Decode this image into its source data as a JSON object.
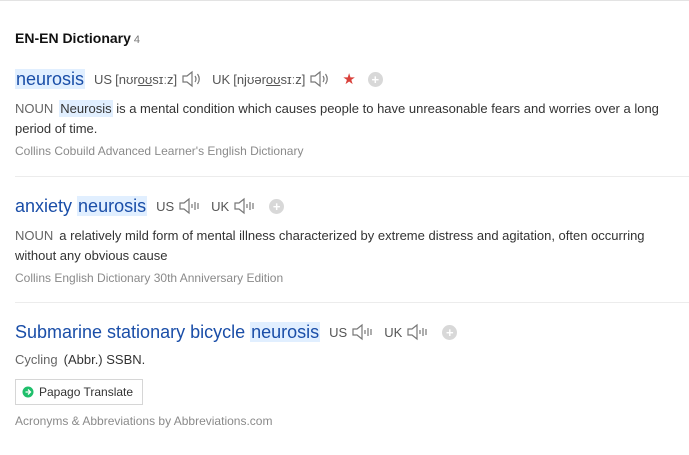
{
  "header": {
    "title": "EN-EN Dictionary",
    "count": "4"
  },
  "entries": [
    {
      "headword_plain": "",
      "headword_hl": "neurosis",
      "us_label": "US",
      "us_ipa_1": "[nʊr",
      "us_ipa_u": "oʊ",
      "us_ipa_2": "sɪːz]",
      "uk_label": "UK",
      "uk_ipa_1": "[njʊər",
      "uk_ipa_u": "oʊ",
      "uk_ipa_2": "sɪːz]",
      "pos": "NOUN",
      "def_kw": "Neurosis",
      "def_rest": " is a mental condition which causes people to have unreasonable fears and worries over a long period of time.",
      "source": "Collins Cobuild Advanced Learner's English Dictionary"
    },
    {
      "headword_plain": "anxiety ",
      "headword_hl": "neurosis",
      "us_label": "US",
      "uk_label": "UK",
      "pos": "NOUN",
      "def_rest": "a relatively mild form of mental illness characterized by extreme distress and agitation, often occurring without any obvious cause",
      "source": "Collins English Dictionary 30th Anniversary Edition"
    },
    {
      "headword_plain": "Submarine stationary bicycle ",
      "headword_hl": "neurosis",
      "us_label": "US",
      "uk_label": "UK",
      "pos": "Cycling",
      "def_rest": "(Abbr.) SSBN.",
      "translate_label": "Papago Translate",
      "source": "Acronyms & Abbreviations by Abbreviations.com"
    }
  ],
  "colors": {
    "headword": "#1a4ea8",
    "highlight": "#e1efff",
    "star": "#d9403a"
  },
  "icons": [
    "speaker-icon",
    "star-icon",
    "plus-icon",
    "papago-icon"
  ]
}
